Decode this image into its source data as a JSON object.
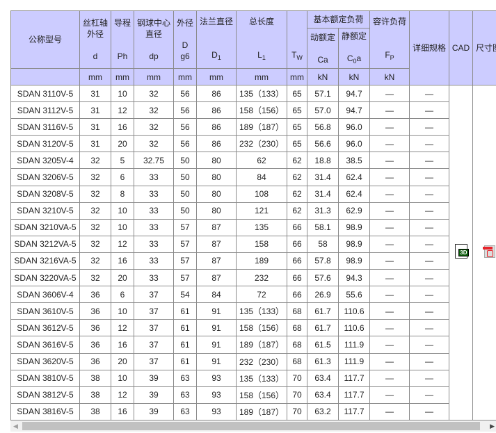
{
  "header": {
    "model": "公称型号",
    "shaft_od": "丝杠轴外径",
    "shaft_sym": "d",
    "lead": "导程",
    "lead_sym": "Ph",
    "ball_center": "钢球中心直径",
    "ball_sym": "dp",
    "outer": "外径",
    "outer_sym": "D",
    "outer_tol": "g6",
    "flange": "法兰直径",
    "flange_sym": "D",
    "flange_sub": "1",
    "length": "总长度",
    "length_sym": "L",
    "length_sub": "1",
    "tw_sym": "T",
    "tw_sub": "W",
    "basic_load": "基本额定负荷",
    "dynamic": "动额定",
    "dynamic_sym": "Ca",
    "static": "静额定",
    "static_sym": "C",
    "static_sub": "0",
    "static_suf": "a",
    "allow_load": "容许负荷",
    "allow_sym": "F",
    "allow_sub": "P",
    "detail": "详细规格",
    "cad": "CAD",
    "dims": "尺寸图",
    "units": [
      "mm",
      "mm",
      "mm",
      "mm",
      "mm",
      "mm",
      "mm",
      "kN",
      "kN",
      "kN"
    ]
  },
  "rows": [
    [
      "SDAN 3110V-5",
      "31",
      "10",
      "32",
      "56",
      "86",
      "135（133）",
      "65",
      "57.1",
      "94.7",
      "—",
      "—"
    ],
    [
      "SDAN 3112V-5",
      "31",
      "12",
      "32",
      "56",
      "86",
      "158（156）",
      "65",
      "57.0",
      "94.7",
      "—",
      "—"
    ],
    [
      "SDAN 3116V-5",
      "31",
      "16",
      "32",
      "56",
      "86",
      "189（187）",
      "65",
      "56.8",
      "96.0",
      "—",
      "—"
    ],
    [
      "SDAN 3120V-5",
      "31",
      "20",
      "32",
      "56",
      "86",
      "232（230）",
      "65",
      "56.6",
      "96.0",
      "—",
      "—"
    ],
    [
      "SDAN 3205V-4",
      "32",
      "5",
      "32.75",
      "50",
      "80",
      "62",
      "62",
      "18.8",
      "38.5",
      "—",
      "—"
    ],
    [
      "SDAN 3206V-5",
      "32",
      "6",
      "33",
      "50",
      "80",
      "84",
      "62",
      "31.4",
      "62.4",
      "—",
      "—"
    ],
    [
      "SDAN 3208V-5",
      "32",
      "8",
      "33",
      "50",
      "80",
      "108",
      "62",
      "31.4",
      "62.4",
      "—",
      "—"
    ],
    [
      "SDAN 3210V-5",
      "32",
      "10",
      "33",
      "50",
      "80",
      "121",
      "62",
      "31.3",
      "62.9",
      "—",
      "—"
    ],
    [
      "SDAN 3210VA-5",
      "32",
      "10",
      "33",
      "57",
      "87",
      "135",
      "66",
      "58.1",
      "98.9",
      "—",
      "—"
    ],
    [
      "SDAN 3212VA-5",
      "32",
      "12",
      "33",
      "57",
      "87",
      "158",
      "66",
      "58",
      "98.9",
      "—",
      "—"
    ],
    [
      "SDAN 3216VA-5",
      "32",
      "16",
      "33",
      "57",
      "87",
      "189",
      "66",
      "57.8",
      "98.9",
      "—",
      "—"
    ],
    [
      "SDAN 3220VA-5",
      "32",
      "20",
      "33",
      "57",
      "87",
      "232",
      "66",
      "57.6",
      "94.3",
      "—",
      "—"
    ],
    [
      "SDAN 3606V-4",
      "36",
      "6",
      "37",
      "54",
      "84",
      "72",
      "66",
      "26.9",
      "55.6",
      "—",
      "—"
    ],
    [
      "SDAN 3610V-5",
      "36",
      "10",
      "37",
      "61",
      "91",
      "135（133）",
      "68",
      "61.7",
      "110.6",
      "—",
      "—"
    ],
    [
      "SDAN 3612V-5",
      "36",
      "12",
      "37",
      "61",
      "91",
      "158（156）",
      "68",
      "61.7",
      "110.6",
      "—",
      "—"
    ],
    [
      "SDAN 3616V-5",
      "36",
      "16",
      "37",
      "61",
      "91",
      "189（187）",
      "68",
      "61.5",
      "111.9",
      "—",
      "—"
    ],
    [
      "SDAN 3620V-5",
      "36",
      "20",
      "37",
      "61",
      "91",
      "232（230）",
      "68",
      "61.3",
      "111.9",
      "—",
      "—"
    ],
    [
      "SDAN 3810V-5",
      "38",
      "10",
      "39",
      "63",
      "93",
      "135（133）",
      "70",
      "63.4",
      "117.7",
      "—",
      "—"
    ],
    [
      "SDAN 3812V-5",
      "38",
      "12",
      "39",
      "63",
      "93",
      "158（156）",
      "70",
      "63.4",
      "117.7",
      "—",
      "—"
    ],
    [
      "SDAN 3816V-5",
      "38",
      "16",
      "39",
      "63",
      "93",
      "189（187）",
      "70",
      "63.2",
      "117.7",
      "—",
      "—"
    ]
  ],
  "icons": {
    "cad": "cad-3d-file-icon",
    "dims": "pdf-icon"
  },
  "colors": {
    "header_bg": "#ccccff",
    "border": "#8a8a8a"
  }
}
